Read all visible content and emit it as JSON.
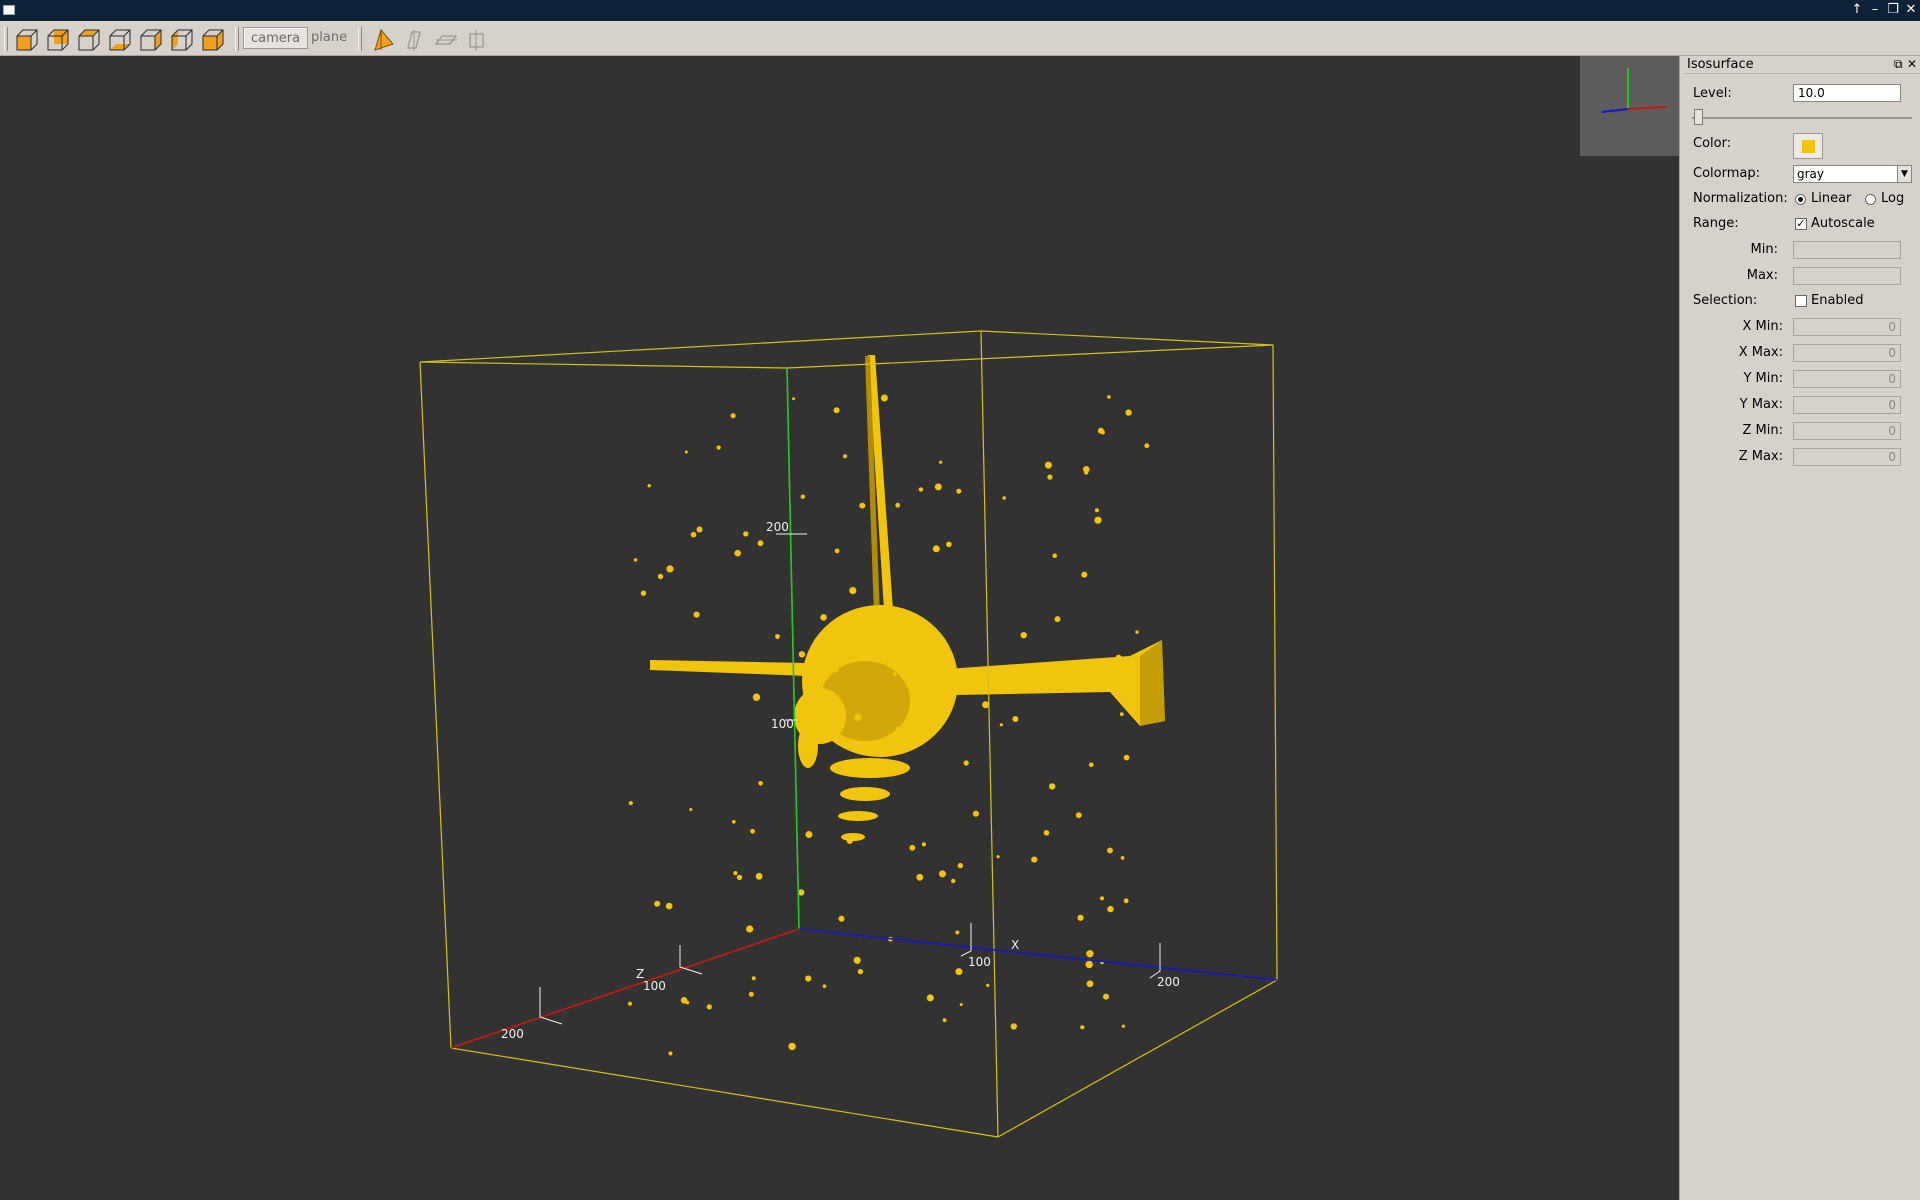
{
  "toolbar": {
    "view_buttons": [
      "view-front-icon",
      "view-back-icon",
      "view-top-icon",
      "view-bottom-icon",
      "view-right-icon",
      "view-left-icon",
      "view-side-icon"
    ],
    "camera_label": "camera",
    "plane_label": "plane"
  },
  "scene": {
    "box_color": "#d4c21a",
    "isosurface_color": "#f1c50d",
    "axis_colors": {
      "x": "#1414c8",
      "y": "#22c822",
      "z": "#c81414"
    },
    "axis_x_name": "X",
    "axis_z_name": "Z",
    "x_ticks": [
      "100",
      "200"
    ],
    "y_ticks": [
      "100",
      "200"
    ],
    "z_ticks": [
      "100",
      "200"
    ]
  },
  "panel": {
    "title": "Isosurface",
    "level_label": "Level:",
    "level_value": "10.0",
    "level_slider_fraction": 0.0,
    "color_label": "Color:",
    "color_value": "#f1c50d",
    "colormap_label": "Colormap:",
    "colormap_value": "gray",
    "normalization_label": "Normalization:",
    "norm_linear": "Linear",
    "norm_log": "Log",
    "normalization_selected": "Linear",
    "range_label": "Range:",
    "autoscale_label": "Autoscale",
    "autoscale_checked": true,
    "min_label": "Min:",
    "max_label": "Max:",
    "selection_label": "Selection:",
    "enabled_label": "Enabled",
    "enabled_checked": false,
    "xmin_label": "X Min:",
    "xmin_value": "0",
    "xmax_label": "X Max:",
    "xmax_value": "0",
    "ymin_label": "Y Min:",
    "ymin_value": "0",
    "ymax_label": "Y Max:",
    "ymax_value": "0",
    "zmin_label": "Z Min:",
    "zmin_value": "0",
    "zmax_label": "Z Max:",
    "zmax_value": "0"
  }
}
